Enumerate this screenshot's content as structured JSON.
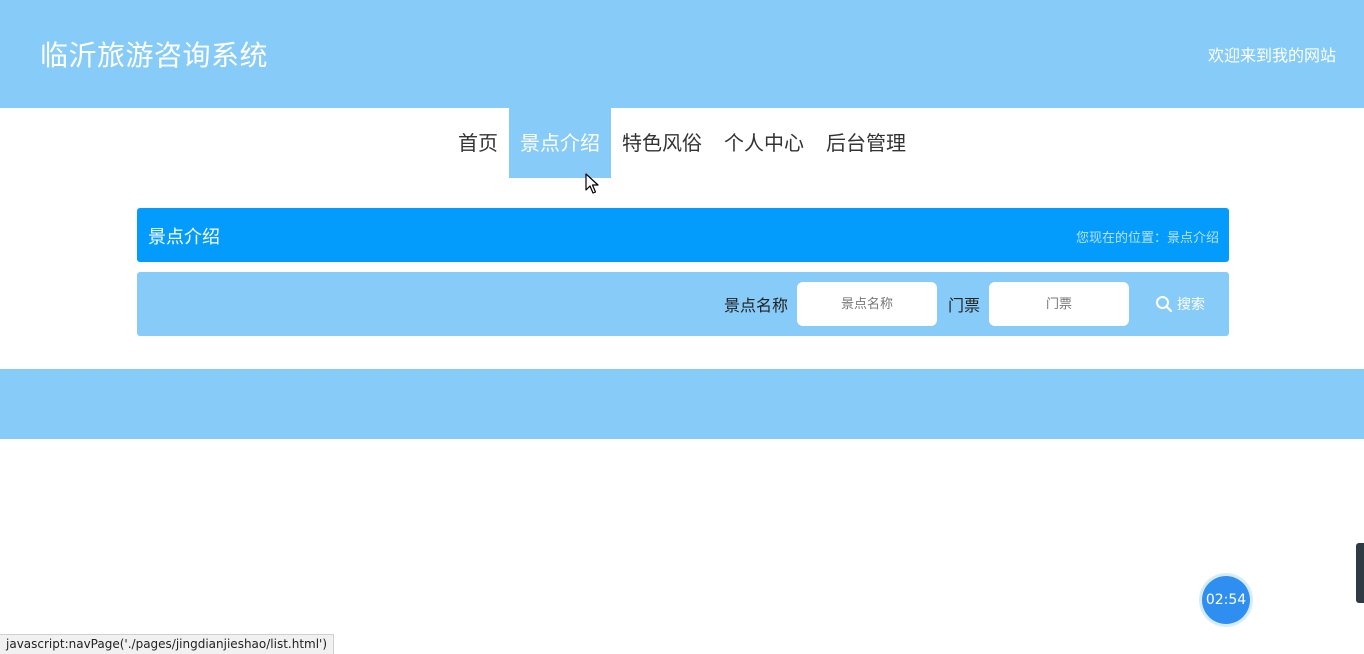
{
  "header": {
    "title": "临沂旅游咨询系统",
    "welcome": "欢迎来到我的网站"
  },
  "nav": {
    "items": [
      {
        "label": "首页"
      },
      {
        "label": "景点介绍",
        "active": true
      },
      {
        "label": "特色风俗"
      },
      {
        "label": "个人中心"
      },
      {
        "label": "后台管理"
      }
    ]
  },
  "section": {
    "title": "景点介绍",
    "location": "您现在的位置：景点介绍"
  },
  "search": {
    "name_label": "景点名称",
    "name_placeholder": "景点名称",
    "ticket_label": "门票",
    "ticket_placeholder": "门票",
    "button_label": "搜索",
    "button_icon": "search-icon"
  },
  "timer": {
    "text": "02:54"
  },
  "status_bar": {
    "url": "javascript:navPage('./pages/jingdianjieshao/list.html')"
  },
  "colors": {
    "header_bg": "#87cbf8",
    "section_bg": "#039cfd",
    "timer_bg": "#2f8ff1"
  }
}
